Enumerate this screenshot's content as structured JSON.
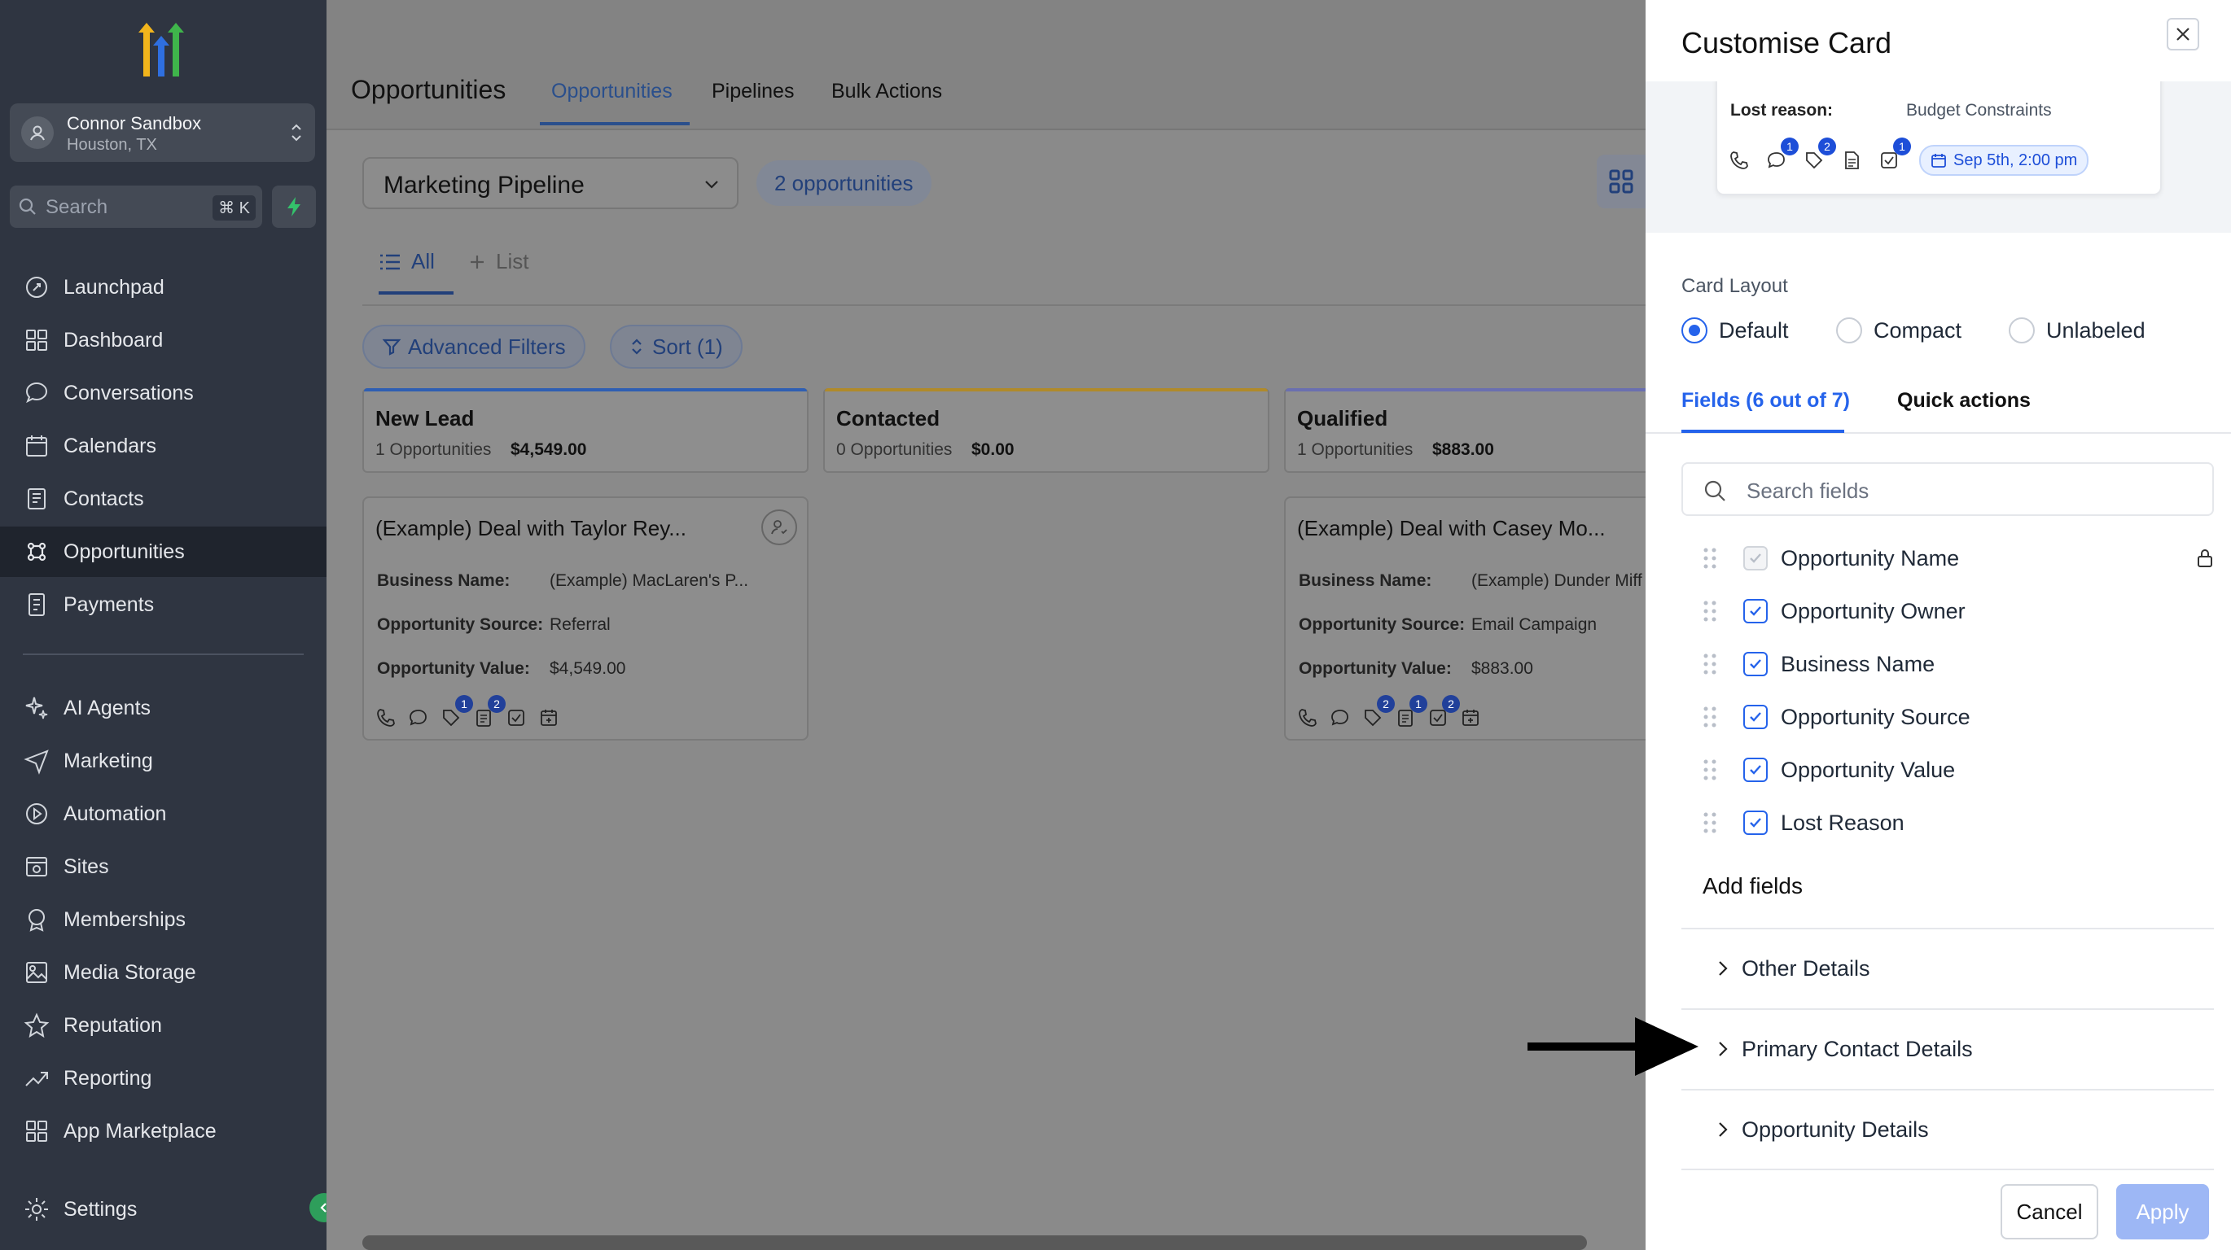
{
  "sidebar": {
    "account": {
      "name": "Connor Sandbox",
      "location": "Houston, TX"
    },
    "search": {
      "placeholder": "Search",
      "shortcut": "⌘ K"
    },
    "items": [
      {
        "label": "Launchpad",
        "icon": "rocket-icon"
      },
      {
        "label": "Dashboard",
        "icon": "grid-icon"
      },
      {
        "label": "Conversations",
        "icon": "chat-icon"
      },
      {
        "label": "Calendars",
        "icon": "calendar-icon"
      },
      {
        "label": "Contacts",
        "icon": "contacts-icon"
      },
      {
        "label": "Opportunities",
        "icon": "opportunities-icon",
        "active": true
      },
      {
        "label": "Payments",
        "icon": "payments-icon"
      },
      {
        "label": "AI Agents",
        "icon": "sparkle-icon"
      },
      {
        "label": "Marketing",
        "icon": "send-icon"
      },
      {
        "label": "Automation",
        "icon": "automation-icon"
      },
      {
        "label": "Sites",
        "icon": "sites-icon"
      },
      {
        "label": "Memberships",
        "icon": "memberships-icon"
      },
      {
        "label": "Media Storage",
        "icon": "image-icon"
      },
      {
        "label": "Reputation",
        "icon": "star-icon"
      },
      {
        "label": "Reporting",
        "icon": "trend-icon"
      },
      {
        "label": "App Marketplace",
        "icon": "apps-icon"
      },
      {
        "label": "Settings",
        "icon": "gear-icon"
      }
    ]
  },
  "header": {
    "title": "Opportunities",
    "tabs": [
      "Opportunities",
      "Pipelines",
      "Bulk Actions"
    ]
  },
  "toolbar": {
    "pipeline": "Marketing Pipeline",
    "count": "2 opportunities",
    "view_all": "All",
    "view_add": "List",
    "filters": "Advanced Filters",
    "sort": "Sort (1)"
  },
  "stages": [
    {
      "name": "New Lead",
      "count": "1 Opportunities",
      "amount": "$4,549.00",
      "color": "#2f5fb3"
    },
    {
      "name": "Contacted",
      "count": "0 Opportunities",
      "amount": "$0.00",
      "color": "#b08a2a"
    },
    {
      "name": "Qualified",
      "count": "1 Opportunities",
      "amount": "$883.00",
      "color": "#6a6fb0"
    }
  ],
  "cards": [
    {
      "title": "(Example) Deal with Taylor Rey...",
      "fields": [
        {
          "k": "Business Name:",
          "v": "(Example) MacLaren's P..."
        },
        {
          "k": "Opportunity Source:",
          "v": "Referral"
        },
        {
          "k": "Opportunity Value:",
          "v": "$4,549.00"
        }
      ],
      "badges": {
        "tasks": "1",
        "notes": "2"
      }
    },
    {
      "title": "(Example) Deal with Casey Mo...",
      "fields": [
        {
          "k": "Business Name:",
          "v": "(Example) Dunder Miff"
        },
        {
          "k": "Opportunity Source:",
          "v": "Email Campaign"
        },
        {
          "k": "Opportunity Value:",
          "v": "$883.00"
        }
      ],
      "badges": {
        "tasks": "2",
        "notes": "1",
        "checks": "2"
      }
    }
  ],
  "drawer": {
    "title": "Customise Card",
    "preview": {
      "lost_reason_label": "Lost reason:",
      "lost_reason_value": "Budget Constraints",
      "badges": [
        "1",
        "2",
        "1"
      ],
      "date_chip": "Sep 5th, 2:00 pm"
    },
    "layout_label": "Card Layout",
    "layouts": [
      "Default",
      "Compact",
      "Unlabeled"
    ],
    "selected_layout": "Default",
    "tabs": [
      "Fields (6 out of 7)",
      "Quick actions"
    ],
    "search_placeholder": "Search fields",
    "fields": [
      {
        "label": "Opportunity Name",
        "checked": true,
        "locked": true
      },
      {
        "label": "Opportunity Owner",
        "checked": true
      },
      {
        "label": "Business Name",
        "checked": true
      },
      {
        "label": "Opportunity Source",
        "checked": true
      },
      {
        "label": "Opportunity Value",
        "checked": true
      },
      {
        "label": "Lost Reason",
        "checked": true
      }
    ],
    "add_fields_label": "Add fields",
    "groups": [
      "Other Details",
      "Primary Contact Details",
      "Opportunity Details"
    ],
    "cancel": "Cancel",
    "apply": "Apply"
  }
}
